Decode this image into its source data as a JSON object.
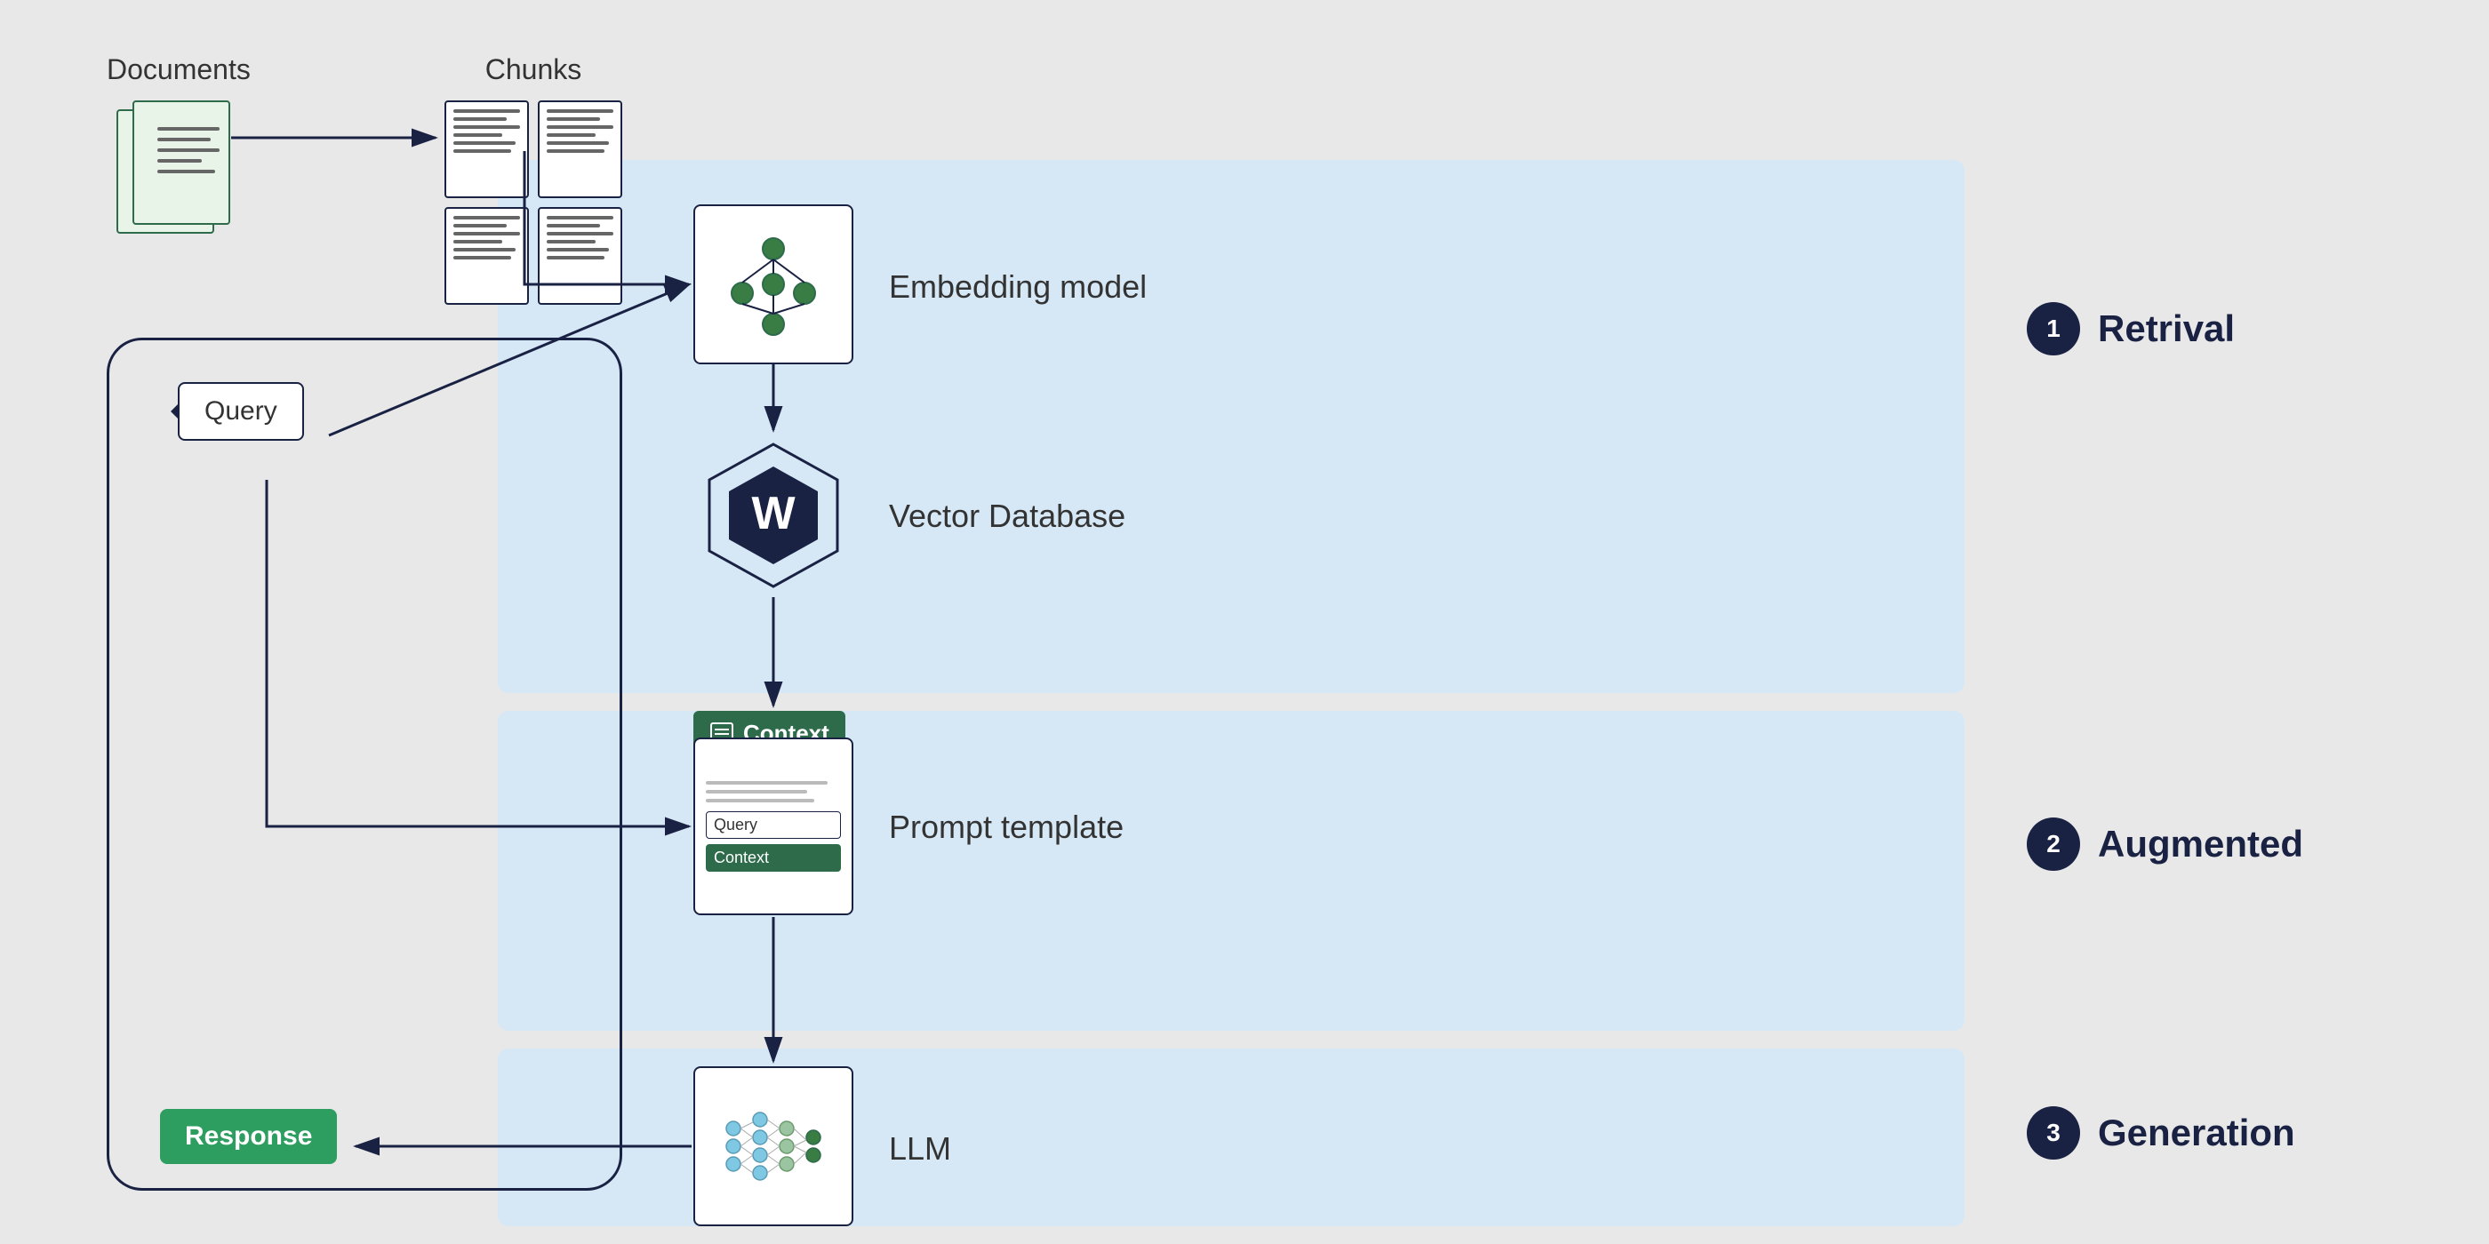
{
  "labels": {
    "documents": "Documents",
    "chunks": "Chunks",
    "embedding_model": "Embedding model",
    "vector_database": "Vector Database",
    "context": "Context",
    "prompt_template": "Prompt template",
    "llm": "LLM",
    "query": "Query",
    "response": "Response",
    "query_inner": "Query",
    "context_inner": "Context"
  },
  "sections": {
    "retrieval": {
      "number": "1",
      "label": "Retrival"
    },
    "augmented": {
      "number": "2",
      "label": "Augmented"
    },
    "generation": {
      "number": "3",
      "label": "Generation"
    }
  },
  "colors": {
    "dark_navy": "#1a2244",
    "green_dark": "#2d6b4a",
    "green_badge": "#2d9e5f",
    "blue_panel": "#d6e8f5",
    "background": "#e8e8e8"
  }
}
